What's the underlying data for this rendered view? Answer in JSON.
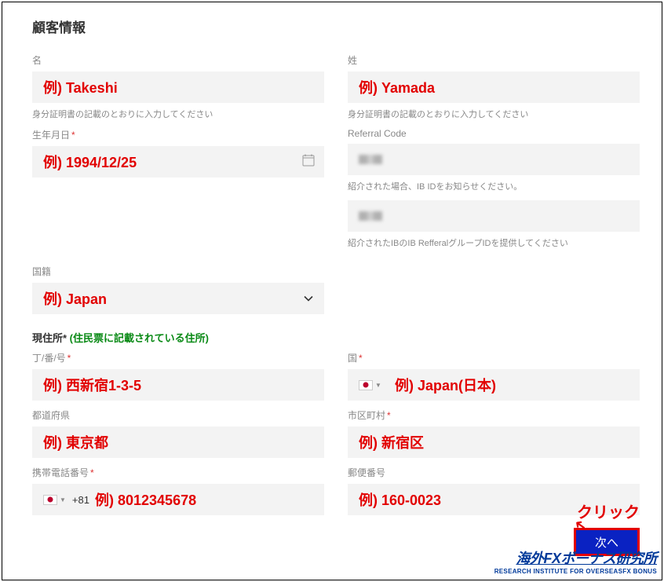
{
  "title": "顧客情報",
  "left": {
    "name_label": "名",
    "name_example": "例) Takeshi",
    "name_help": "身分証明書の記載のとおりに入力してください",
    "dob_label": "生年月日",
    "dob_example": "例) 1994/12/25",
    "nationality_label": "国籍",
    "nationality_example": "例) Japan"
  },
  "right": {
    "surname_label": "姓",
    "surname_example": "例) Yamada",
    "surname_help": "身分証明書の記載のとおりに入力してください",
    "ref_label": "Referral Code",
    "ref_help1": "紹介された場合、IB IDをお知らせください。",
    "ref_help2": "紹介されたIBのIB RefferalグループIDを提供してください"
  },
  "address": {
    "header_main": "現住所*",
    "header_note": " (住民票に記載されている住所)",
    "street_label": "丁/番/号",
    "street_example": "例) 西新宿1-3-5",
    "country_label": "国",
    "country_example": "例) Japan(日本)",
    "prefecture_label": "都道府県",
    "prefecture_example": "例) 東京都",
    "city_label": "市区町村",
    "city_example": "例) 新宿区",
    "phone_label": "携帯電話番号",
    "phone_prefix": "+81",
    "phone_example": "例) 8012345678",
    "postal_label": "郵便番号",
    "postal_example": "例) 160-0023"
  },
  "next_button": "次へ",
  "click_label": "クリック",
  "logo_top": "海外FXボーナス研究所",
  "logo_bottom": "RESEARCH INSTITUTE FOR OVERSEASFX BONUS"
}
